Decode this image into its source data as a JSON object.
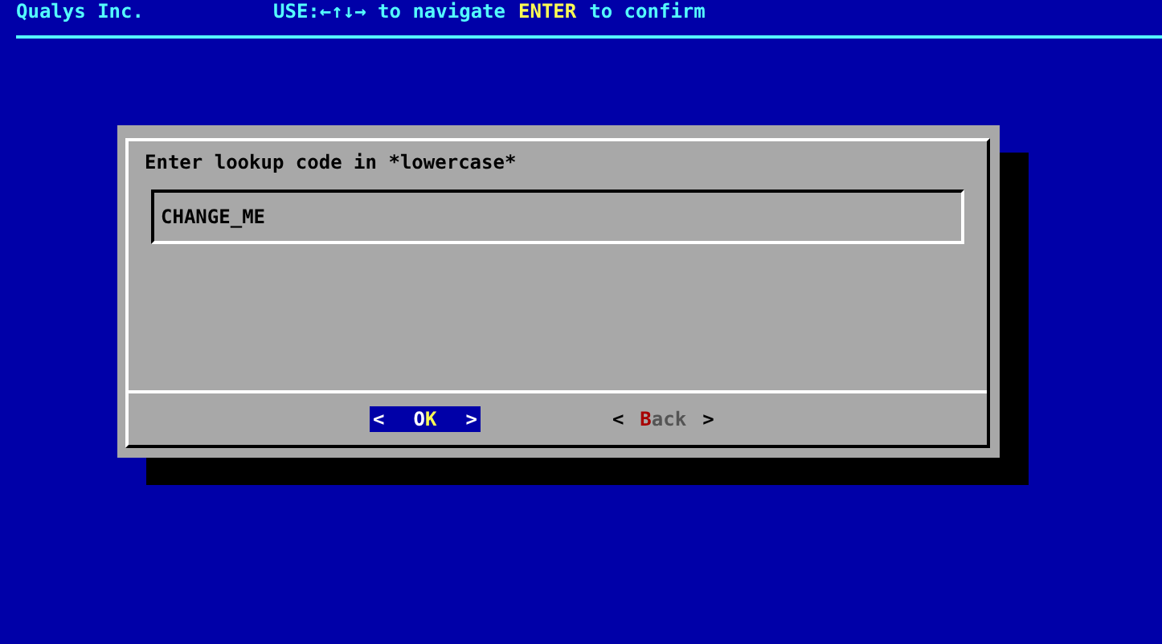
{
  "backtitle": {
    "title": "Qualys Inc.",
    "hint": [
      {
        "text": "USE:←↑↓→ to navigate",
        "highlight": false
      },
      {
        "text": "ENTER",
        "highlight": true
      },
      {
        "text": "to confirm",
        "highlight": false
      }
    ]
  },
  "dialog": {
    "prompt": "Enter lookup code in *lowercase*",
    "input": {
      "value": "CHANGE_ME"
    },
    "buttons": [
      {
        "left": "<",
        "label": "OK",
        "right": ">",
        "selected": true
      },
      {
        "left": "<",
        "label": "Back",
        "right": ">",
        "selected": false
      }
    ]
  }
}
